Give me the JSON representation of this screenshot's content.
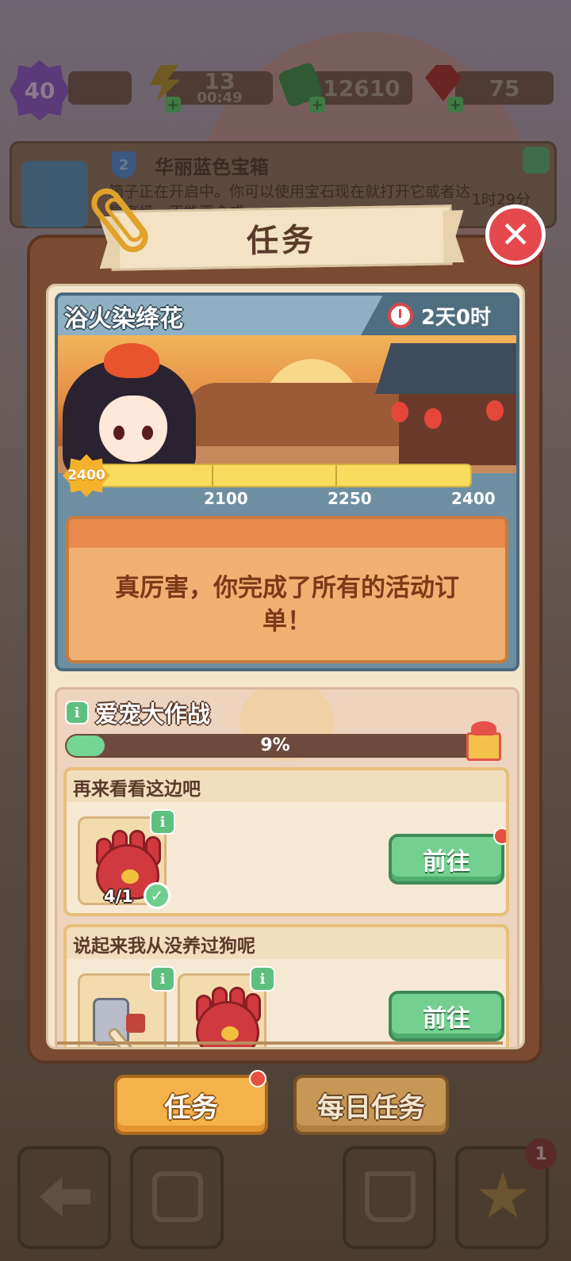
{
  "hud": {
    "level": "40",
    "energy": "13",
    "energy_timer": "00:49",
    "cash": "12610",
    "gems": "75"
  },
  "chest_banner": {
    "tier": "2",
    "title": "华丽蓝色宝箱",
    "description": "箱子正在开启中。你可以使用宝石现在就打开它或者达最高级，不能再合成",
    "time_left": "1时29分"
  },
  "modal": {
    "title": "任务",
    "close_glyph": "✕"
  },
  "event": {
    "title": "浴火染绛花",
    "time_left": "2天0时",
    "current_points": "2400",
    "milestones": [
      "2100",
      "2250",
      "2400"
    ],
    "message": "真厉害，你完成了所有的活动订单！"
  },
  "pet_event": {
    "title": "爱宠大作战",
    "info_glyph": "i",
    "progress_text": "9%",
    "progress_percent": 9,
    "tasks": [
      {
        "title": "再来看看这边吧",
        "item_count": "4/1",
        "button": "前往"
      },
      {
        "title": "说起来我从没养过狗呢",
        "button": "前往"
      }
    ]
  },
  "tabs": {
    "tasks": "任务",
    "daily_tasks": "每日任务"
  },
  "bottom_nav": {
    "favorites_badge": "1"
  },
  "colors": {
    "close_red": "#e5484d",
    "go_green": "#74d08f",
    "tab_orange": "#f6b24a",
    "progress_yellow": "#f9db5d"
  }
}
